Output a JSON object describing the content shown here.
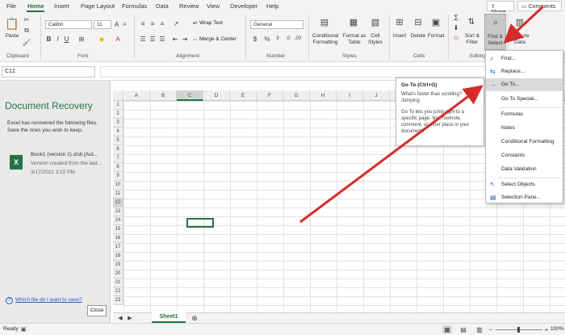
{
  "menu": {
    "tabs": [
      "File",
      "Home",
      "Insert",
      "Page Layout",
      "Formulas",
      "Data",
      "Review",
      "View",
      "Developer",
      "Help"
    ],
    "share": "Share",
    "comments": "Comments"
  },
  "ribbon": {
    "clipboard": {
      "paste": "Paste",
      "label": "Clipboard"
    },
    "font": {
      "name": "Calibri",
      "size": "11",
      "label": "Font"
    },
    "alignment": {
      "wrap": "Wrap Text",
      "merge": "Merge & Center",
      "label": "Alignment"
    },
    "number": {
      "format": "General",
      "label": "Number"
    },
    "styles": {
      "conditional": "Conditional\nFormatting",
      "format_table": "Format as\nTable",
      "cell_styles": "Cell\nStyles",
      "label": "Styles"
    },
    "cells": {
      "insert": "Insert",
      "delete": "Delete",
      "format": "Format",
      "label": "Cells"
    },
    "editing": {
      "sort": "Sort &\nFilter",
      "find": "Find &\nSelect",
      "label": "Editing"
    },
    "analyze": "Analyze\nData"
  },
  "formula": {
    "namebox": "C12"
  },
  "recovery": {
    "title": "Document Recovery",
    "description": "Excel has recovered the following files.  Save the ones you wish to keep.",
    "file_name": "Book1 (version 1).xlsb  [Aut...",
    "file_sub": "Version created from the last...",
    "file_date": "3/17/2021 3:22 PM",
    "link": "Which file do I want to save?",
    "close": "Close"
  },
  "grid": {
    "columns": [
      "A",
      "B",
      "C",
      "D",
      "E",
      "F",
      "G",
      "H",
      "I",
      "J",
      "K"
    ],
    "rows": [
      "1",
      "2",
      "3",
      "4",
      "5",
      "6",
      "7",
      "8",
      "9",
      "10",
      "11",
      "12",
      "13",
      "14",
      "15",
      "16",
      "17",
      "18",
      "19",
      "20",
      "21",
      "22",
      "23"
    ],
    "selected_column": "C",
    "selected_row": "12"
  },
  "sheet": {
    "tab": "Sheet1"
  },
  "status": {
    "ready": "Ready",
    "zoom": "100%"
  },
  "tooltip": {
    "title": "Go To (Ctrl+G)",
    "p1": "What's faster than scrolling? Jumping.",
    "p2": "Go To lets you jump right to a specific page, line, footnote, comment, or other place in your document."
  },
  "dropdown": {
    "find": "Find...",
    "replace": "Replace...",
    "goto": "Go To...",
    "goto_special": "Go To Special...",
    "formulas": "Formulas",
    "notes": "Notes",
    "conditional": "Conditional Formatting",
    "constants": "Constants",
    "validation": "Data Validation",
    "select_objects": "Select Objects",
    "selection_pane": "Selection Pane..."
  },
  "colors": {
    "accent": "#217346",
    "arrow": "#d62b2b"
  }
}
